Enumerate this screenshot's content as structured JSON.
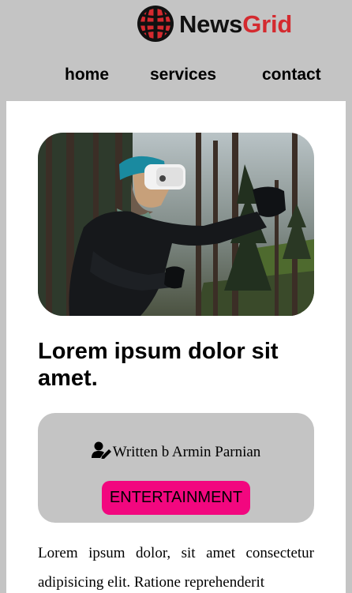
{
  "brand": {
    "part1": "News",
    "part2": "Grid",
    "accent": "#d42a2f",
    "icon": "globe-logo-icon"
  },
  "nav": [
    {
      "label": "home"
    },
    {
      "label": "services"
    },
    {
      "label": "contact"
    }
  ],
  "article": {
    "image": "man-in-vr-headset-forest-photo",
    "title": "Lorem ipsum dolor sit amet.",
    "author_icon": "user-pen-icon",
    "author": "Written b Armin Parnian",
    "category": "ENTERTAINMENT",
    "category_color": "#f2077f",
    "body": "Lorem ipsum dolor, sit amet consectetur adipisicing elit. Ratione reprehenderit"
  }
}
